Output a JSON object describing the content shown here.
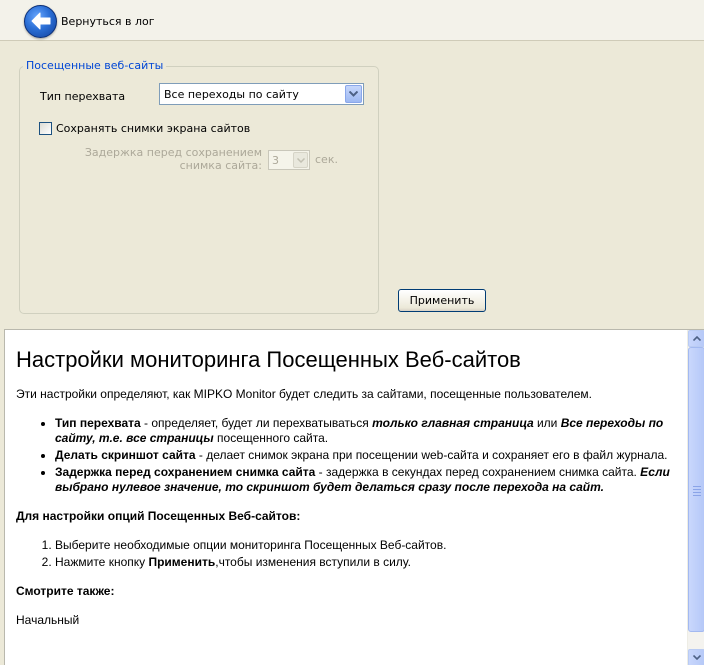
{
  "toolbar": {
    "back_label": "Вернуться в лог"
  },
  "settings": {
    "group_title": "Посещенные веб-сайты",
    "capture_type_label": "Тип перехвата",
    "capture_type_value": "Все переходы по сайту",
    "screenshot_checkbox_label": "Сохранять снимки экрана сайтов",
    "screenshot_checked": false,
    "delay_label_line1": "Задержка перед сохранением",
    "delay_label_line2": "снимка сайта:",
    "delay_value": "3",
    "delay_unit": "сек.",
    "apply_label": "Применить"
  },
  "help": {
    "title": "Настройки мониторинга Посещенных Веб-сайтов",
    "intro": "Эти настройки определяют, как MIPKO Monitor будет следить за сайтами, посещенные пользователем.",
    "bullets": [
      {
        "term": "Тип перехвата",
        "text1": " - определяет, будет ли перехватываться ",
        "em1": "только главная страница",
        "text2": " или ",
        "em2": "Все переходы по сайту, т.е. все страницы",
        "text3": " посещенного сайта."
      },
      {
        "term": "Делать скриншот сайта",
        "text1": " - делает снимок экрана при посещении web-сайта и сохраняет его в файл журнала."
      },
      {
        "term": "Задержка перед сохранением снимка сайта",
        "text1": " - задержка в секундах перед сохранением снимка сайта. ",
        "em1": "Если выбрано нулевое значение, то скриншот будет делаться сразу после перехода на сайт."
      }
    ],
    "howto_title": "Для настройки опций Посещенных Веб-сайтов:",
    "steps": [
      {
        "text": "Выберите необходимые опции мониторинга Посещенных Веб-сайтов."
      },
      {
        "pre": "Нажмите кнопку ",
        "bold": "Применить",
        "post": ",чтобы изменения вступили в силу."
      }
    ],
    "see_also_title": "Смотрите также:",
    "see_also_partial": "Начальный"
  }
}
